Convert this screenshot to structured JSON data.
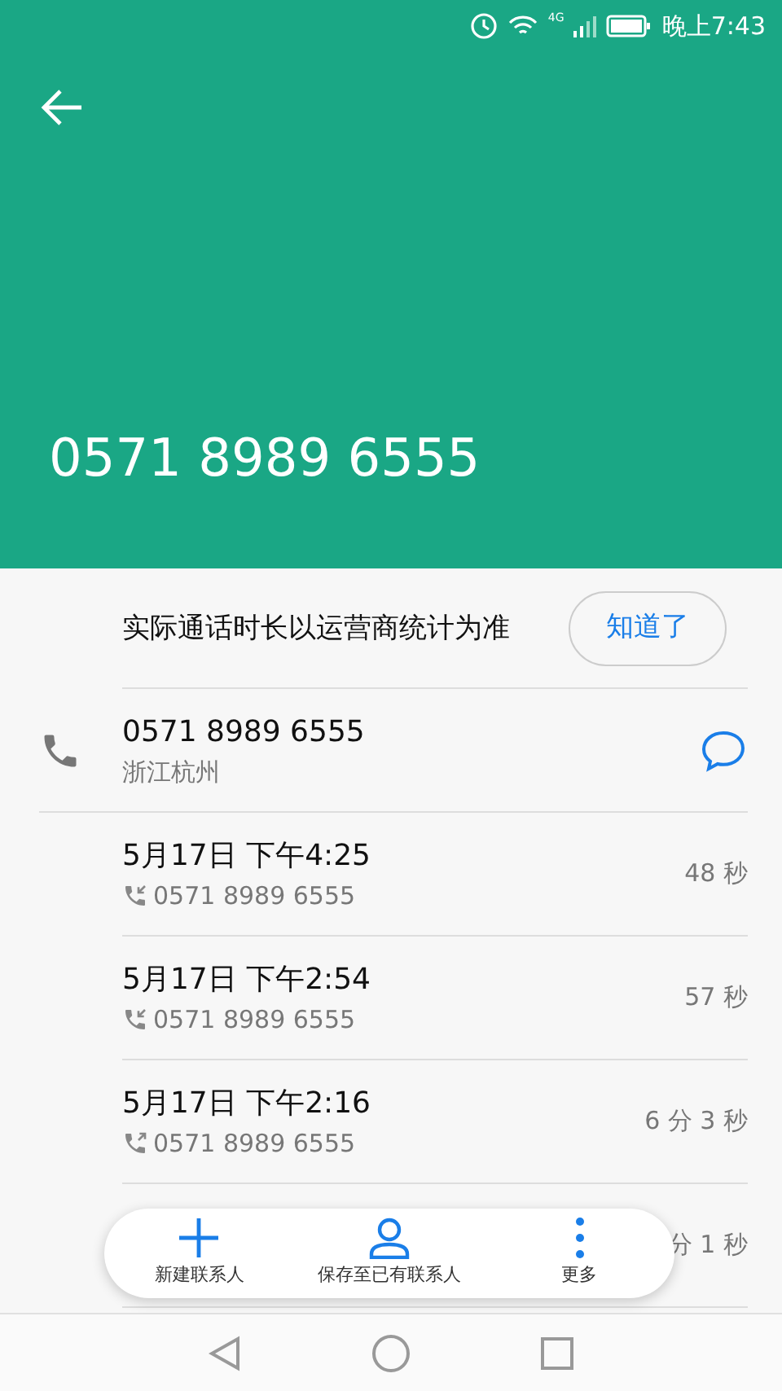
{
  "status_bar": {
    "time": "晚上7:43",
    "network": "4G"
  },
  "header": {
    "number": "0571 8989 6555"
  },
  "notice": {
    "text": "实际通话时长以运营商统计为准",
    "button": "知道了"
  },
  "contact": {
    "number": "0571 8989 6555",
    "location": "浙江杭州"
  },
  "calls": [
    {
      "date": "5月17日 下午4:25",
      "kind": "incoming",
      "number": "0571 8989 6555",
      "duration": "48 秒"
    },
    {
      "date": "5月17日 下午2:54",
      "kind": "incoming",
      "number": "0571 8989 6555",
      "duration": "57 秒"
    },
    {
      "date": "5月17日 下午2:16",
      "kind": "outgoing",
      "number": "0571 8989 6555",
      "duration": "6 分 3 秒"
    }
  ],
  "hidden_call": {
    "duration": "分 1 秒"
  },
  "actions": [
    {
      "kind": "add",
      "label": "新建联系人"
    },
    {
      "kind": "person",
      "label": "保存至已有联系人"
    },
    {
      "kind": "more",
      "label": "更多"
    }
  ]
}
